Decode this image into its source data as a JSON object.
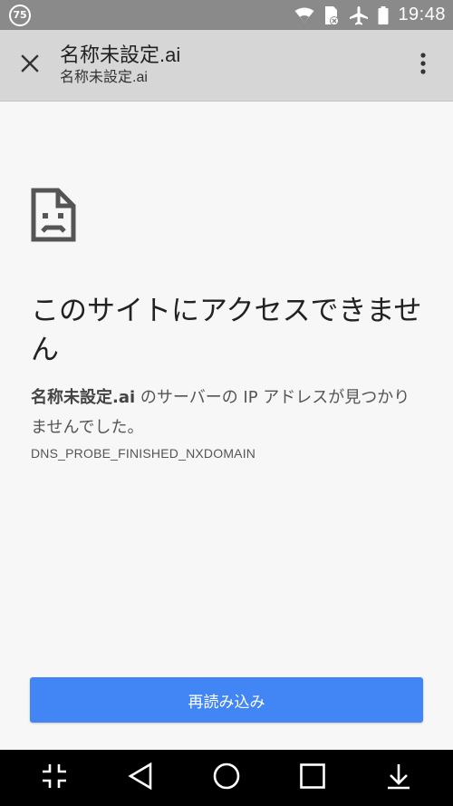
{
  "status_bar": {
    "badge": "75",
    "time": "19:48"
  },
  "toolbar": {
    "title": "名称未設定.ai",
    "subtitle": "名称未設定.ai"
  },
  "error_page": {
    "heading": "このサイトにアクセスできません",
    "domain": "名称未設定.ai",
    "message_suffix": " のサーバーの IP アドレスが見つかりませんでした。",
    "error_code": "DNS_PROBE_FINISHED_NXDOMAIN"
  },
  "reload_button": {
    "label": "再読み込み",
    "color": "#4285f4"
  },
  "nav_bar": {
    "icons": [
      "collapse-icon",
      "back-icon",
      "home-icon",
      "recents-icon",
      "notification-drawer-icon"
    ]
  }
}
